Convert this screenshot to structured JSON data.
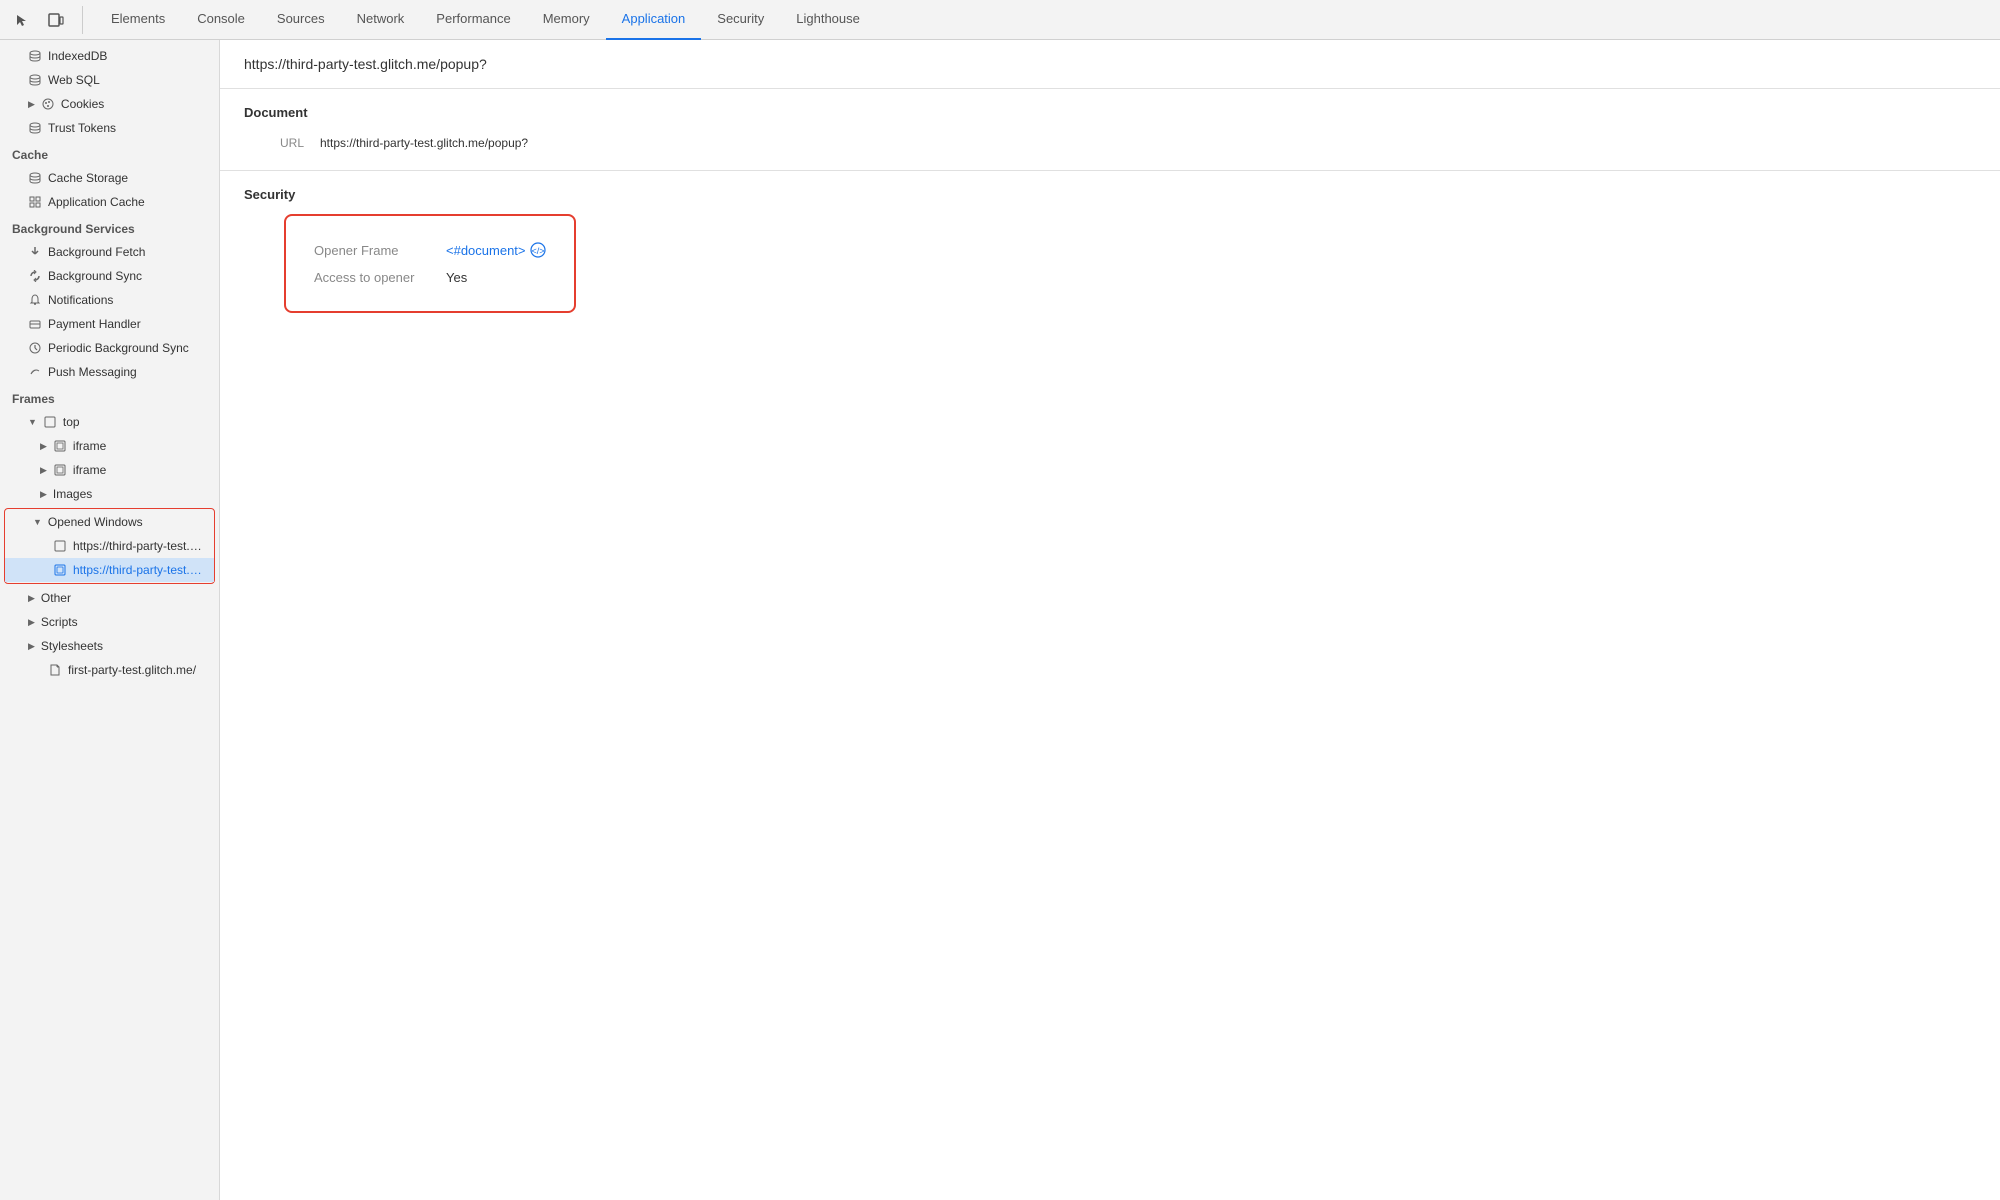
{
  "tabs": [
    {
      "label": "Elements",
      "active": false
    },
    {
      "label": "Console",
      "active": false
    },
    {
      "label": "Sources",
      "active": false
    },
    {
      "label": "Network",
      "active": false
    },
    {
      "label": "Performance",
      "active": false
    },
    {
      "label": "Memory",
      "active": false
    },
    {
      "label": "Application",
      "active": true
    },
    {
      "label": "Security",
      "active": false
    },
    {
      "label": "Lighthouse",
      "active": false
    }
  ],
  "sidebar": {
    "storage_items": [
      {
        "label": "IndexedDB",
        "icon": "db"
      },
      {
        "label": "Web SQL",
        "icon": "db"
      },
      {
        "label": "Cookies",
        "icon": "cookie",
        "expandable": true
      },
      {
        "label": "Trust Tokens",
        "icon": "db"
      }
    ],
    "cache_label": "Cache",
    "cache_items": [
      {
        "label": "Cache Storage",
        "icon": "db"
      },
      {
        "label": "Application Cache",
        "icon": "grid"
      }
    ],
    "bg_services_label": "Background Services",
    "bg_services_items": [
      {
        "label": "Background Fetch",
        "icon": "arrows"
      },
      {
        "label": "Background Sync",
        "icon": "sync"
      },
      {
        "label": "Notifications",
        "icon": "bell"
      },
      {
        "label": "Payment Handler",
        "icon": "card"
      },
      {
        "label": "Periodic Background Sync",
        "icon": "clock"
      },
      {
        "label": "Push Messaging",
        "icon": "cloud"
      }
    ],
    "frames_label": "Frames",
    "frames_items": [
      {
        "label": "top",
        "type": "frame-parent",
        "indent": 1
      },
      {
        "label": "iframe",
        "type": "frame-child",
        "indent": 2
      },
      {
        "label": "iframe",
        "type": "frame-child",
        "indent": 2
      },
      {
        "label": "Images",
        "type": "images",
        "indent": 2
      },
      {
        "label": "Opened Windows",
        "type": "opened-windows-group",
        "indent": 2
      },
      {
        "label": "https://third-party-test.glitch.",
        "type": "window-item",
        "indent": 3
      },
      {
        "label": "https://third-party-test.glitch.",
        "type": "window-item-selected",
        "indent": 3
      },
      {
        "label": "Other",
        "type": "other",
        "indent": 2
      },
      {
        "label": "Scripts",
        "type": "scripts",
        "indent": 2
      },
      {
        "label": "Stylesheets",
        "type": "stylesheets",
        "indent": 2
      },
      {
        "label": "first-party-test.glitch.me/",
        "type": "file",
        "indent": 3
      }
    ]
  },
  "content": {
    "url": "https://third-party-test.glitch.me/popup?",
    "document_label": "Document",
    "url_label": "URL",
    "url_value": "https://third-party-test.glitch.me/popup?",
    "security_label": "Security",
    "opener_frame_label": "Opener Frame",
    "opener_frame_value": "<#document>",
    "access_to_opener_label": "Access to opener",
    "access_to_opener_value": "Yes"
  },
  "icons": {
    "cursor": "⬆",
    "box": "□",
    "chevron_right": "▶",
    "chevron_down": "▼",
    "db_icon": "≡",
    "grid_icon": "⊞",
    "bell_icon": "🔔",
    "sync_icon": "↻",
    "arrows_icon": "⇅",
    "card_icon": "▭",
    "clock_icon": "○",
    "cloud_icon": "☁",
    "frame_icon": "□",
    "doc_icon": "📄",
    "code_icon": "⟨⟩"
  }
}
